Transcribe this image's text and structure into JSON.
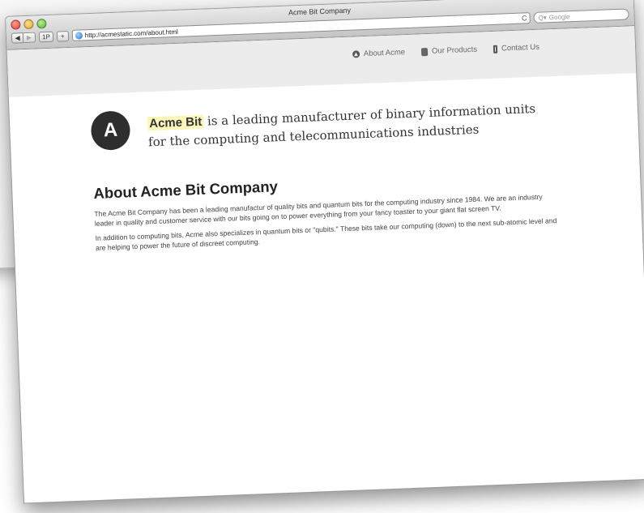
{
  "window": {
    "title": "Acme Bit Company"
  },
  "toolbar": {
    "back_label": "◀",
    "forward_label": "▶",
    "onepassword_label": "1P",
    "add_label": "+",
    "url": "http://acmestatic.com/about.html",
    "reload_label": "C",
    "search_placeholder": "Google",
    "search_prefix": "Q▾"
  },
  "nav": {
    "items": [
      {
        "label": "About Acme",
        "icon": "info-circle-icon"
      },
      {
        "label": "Our Products",
        "icon": "box-icon"
      },
      {
        "label": "Contact Us",
        "icon": "phone-icon"
      }
    ]
  },
  "hero": {
    "logo_letter": "A",
    "brand": "Acme Bit",
    "tagline_rest": " is a leading manufacturer of binary information units for the computing and telecommunications industries"
  },
  "about": {
    "heading": "About Acme Bit Company",
    "paragraphs": [
      "The Acme Bit Company has been a leading manufactur of quality bits and quantum bits for the computing industry since 1984. We are an industry leader in quality and customer service with our bits going on to power everything from your fancy toaster to your giant flat screen TV.",
      "In addition to computing bits, Acme also specializes in quantum bits or \"qubits.\" These bits take our computing (down) to the next sub-atomic level and are helping to power the future of discreet computing."
    ]
  },
  "colors": {
    "nav_background": "#ececec",
    "brand_highlight": "#fbf6b9",
    "logo_background": "#2e2e2e"
  }
}
